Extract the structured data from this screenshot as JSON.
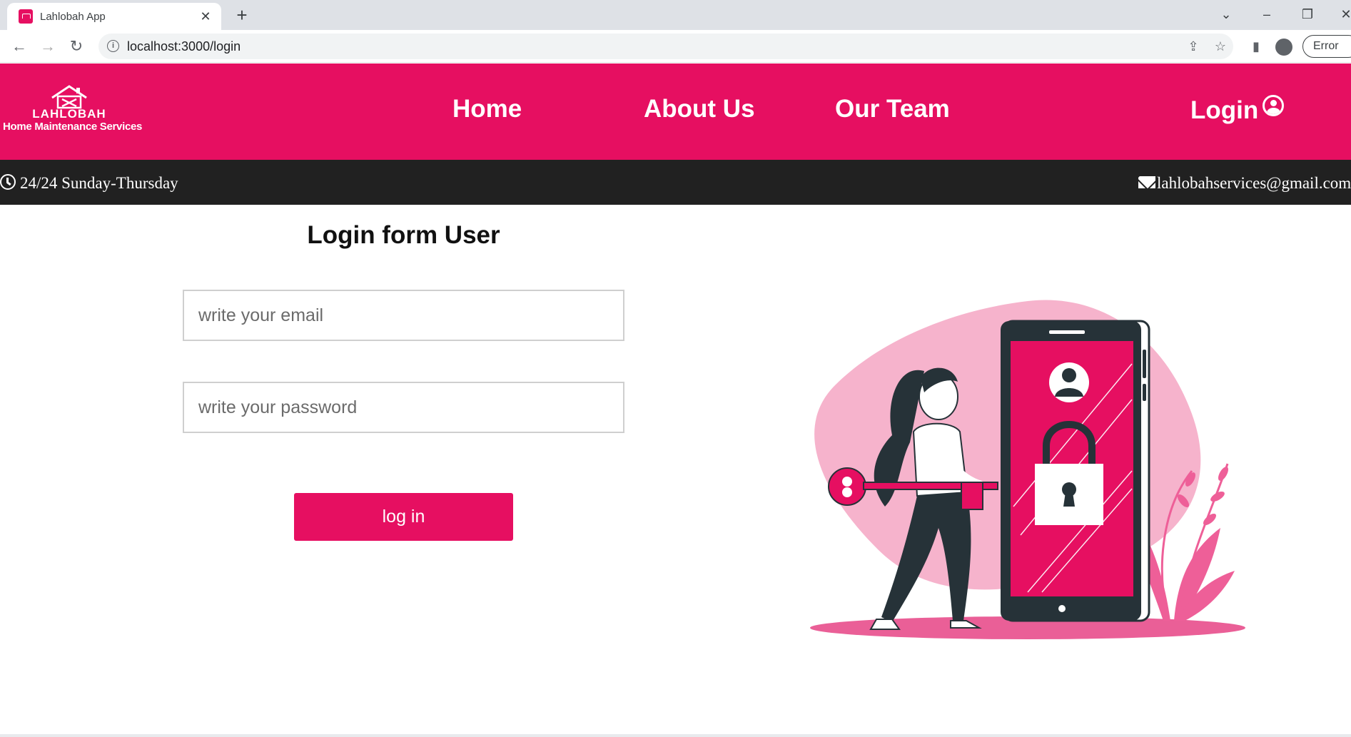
{
  "browser": {
    "tab_title": "Lahlobah App",
    "url": "localhost:3000/login",
    "profile_chip": "Error"
  },
  "navbar": {
    "logo_name": "LAHLOBAH",
    "logo_tagline": "Home Maintenance Services",
    "links": [
      "Home",
      "About Us",
      "Our Team"
    ],
    "login_label": "Login"
  },
  "info_bar": {
    "hours": "24/24 Sunday-Thursday",
    "email": "lahlobahservices@gmail.com"
  },
  "form": {
    "title": "Login form User",
    "email_placeholder": "write your email",
    "password_placeholder": "write your password",
    "submit_label": "log in"
  },
  "colors": {
    "brand": "#e60f61",
    "info_bar": "#212121",
    "illustration_blob": "#f6b3cc"
  },
  "icons": {
    "tab": [
      "favicon-icon",
      "close-icon",
      "plus-icon"
    ],
    "toolbar": [
      "back-icon",
      "forward-icon",
      "reload-icon",
      "info-icon",
      "share-icon",
      "star-icon",
      "side-panel-icon",
      "profile-icon"
    ],
    "navbar": [
      "house-logo-icon",
      "user-circle-icon"
    ],
    "info_bar": [
      "clock-icon",
      "envelope-icon"
    ]
  }
}
